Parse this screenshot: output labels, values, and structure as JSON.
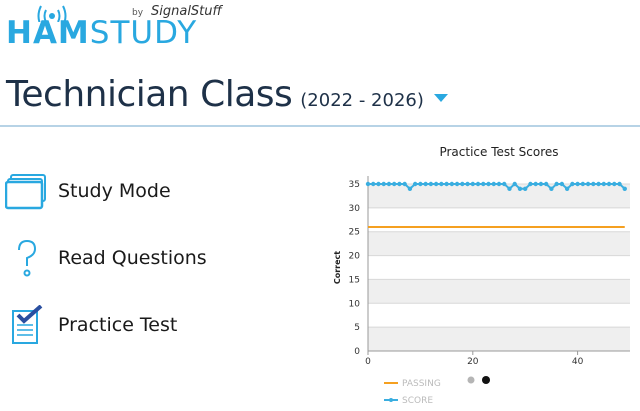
{
  "logo": {
    "ham": "HAM",
    "study": "STUDY",
    "by": "by",
    "brand": "SignalStuff"
  },
  "header": {
    "title": "Technician Class",
    "years": "(2022 - 2026)"
  },
  "menu": [
    {
      "label": "Study Mode",
      "icon": "flashcards-icon"
    },
    {
      "label": "Read Questions",
      "icon": "question-mark-icon"
    },
    {
      "label": "Practice Test",
      "icon": "test-checkmark-icon"
    }
  ],
  "colors": {
    "brand": "#29a8e0",
    "passing": "#f5a020",
    "score": "#3aaee0",
    "title": "#1e3148"
  },
  "chart_data": {
    "type": "line",
    "title": "Practice Test Scores",
    "ylabel": "Correct",
    "xlabel": "",
    "ylim": [
      0,
      35
    ],
    "xlim": [
      0,
      50
    ],
    "yticks": [
      "0",
      "5",
      "10",
      "15",
      "20",
      "25",
      "30",
      "35"
    ],
    "xticks": [
      "0",
      "20",
      "40"
    ],
    "series": [
      {
        "name": "PASSING",
        "x": [
          0,
          49
        ],
        "values": [
          26,
          26
        ]
      },
      {
        "name": "SCORE",
        "x": [
          0,
          1,
          2,
          3,
          4,
          5,
          6,
          7,
          8,
          9,
          10,
          11,
          12,
          13,
          14,
          15,
          16,
          17,
          18,
          19,
          20,
          21,
          22,
          23,
          24,
          25,
          26,
          27,
          28,
          29,
          30,
          31,
          32,
          33,
          34,
          35,
          36,
          37,
          38,
          39,
          40,
          41,
          42,
          43,
          44,
          45,
          46,
          47,
          48,
          49
        ],
        "values": [
          35,
          35,
          35,
          35,
          35,
          35,
          35,
          35,
          34,
          35,
          35,
          35,
          35,
          35,
          35,
          35,
          35,
          35,
          35,
          35,
          35,
          35,
          35,
          35,
          35,
          35,
          35,
          34,
          35,
          34,
          34,
          35,
          35,
          35,
          35,
          34,
          35,
          35,
          34,
          35,
          35,
          35,
          35,
          35,
          35,
          35,
          35,
          35,
          35,
          34
        ]
      }
    ],
    "legend": [
      "PASSING",
      "SCORE"
    ],
    "legend_position": "bottom-left",
    "pager_dots": 2
  }
}
